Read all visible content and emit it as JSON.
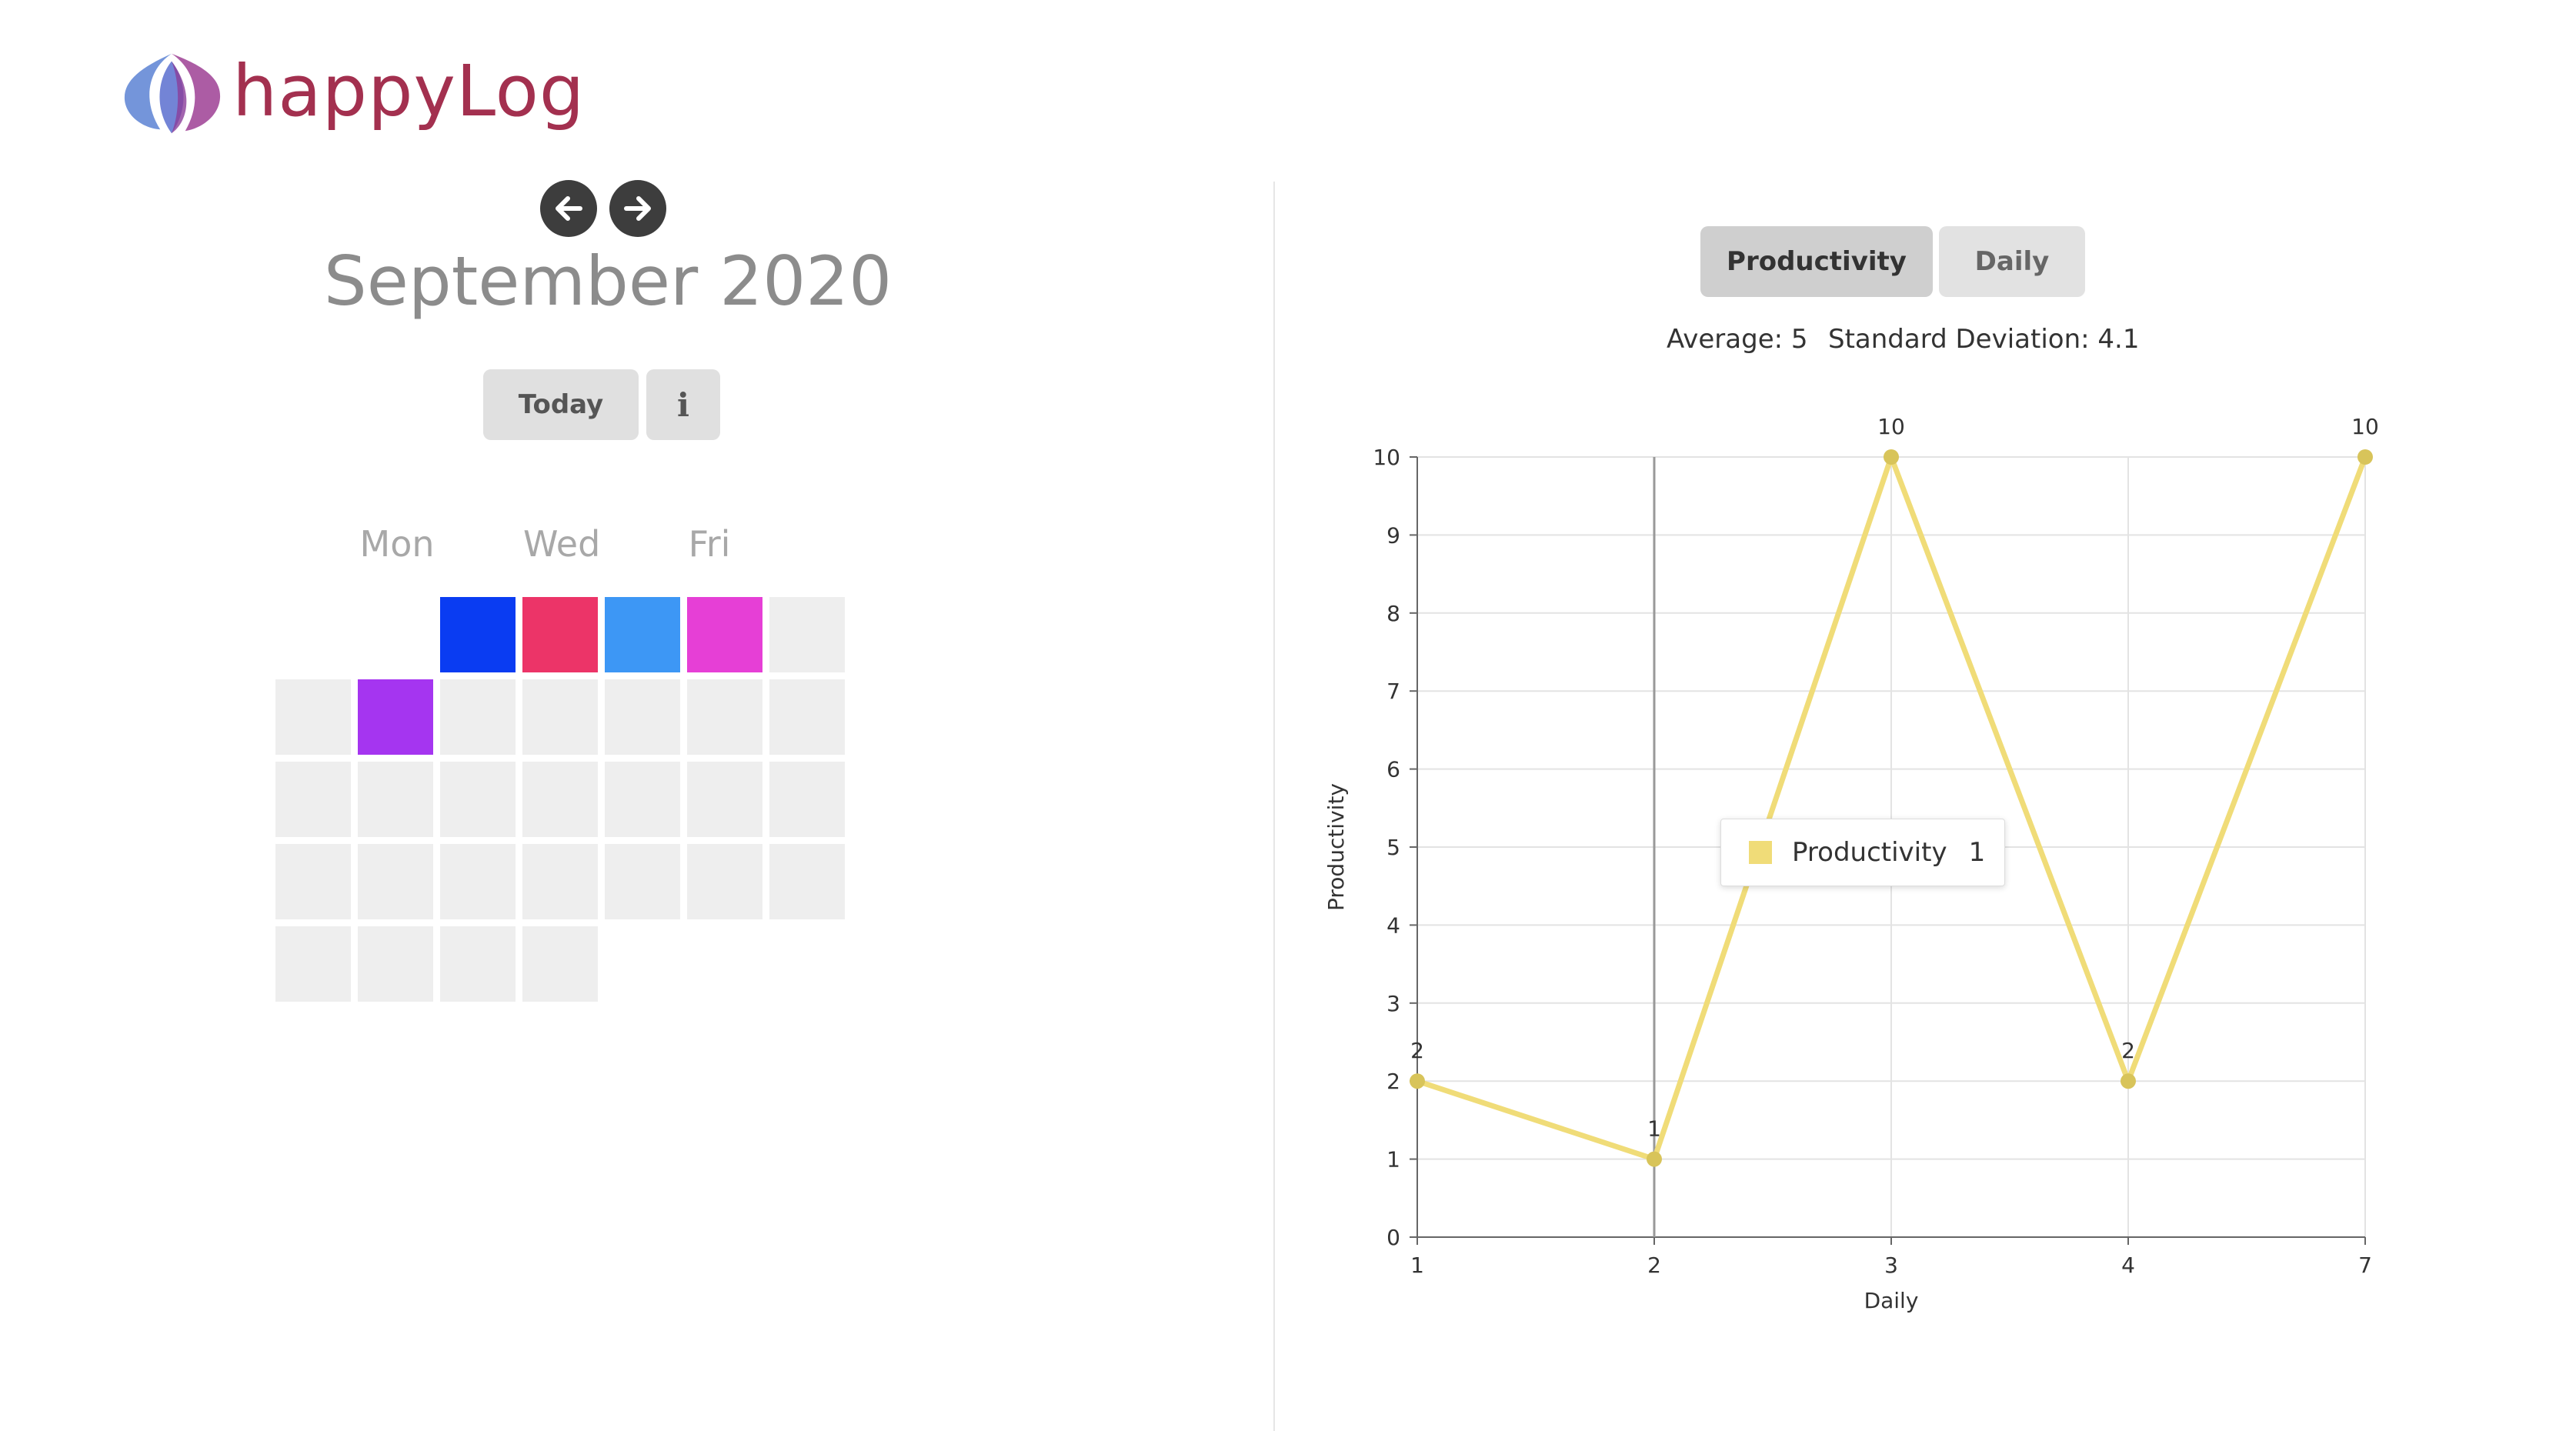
{
  "app": {
    "name": "happyLog"
  },
  "calendar": {
    "month_title": "September 2020",
    "today_label": "Today",
    "info_icon": "info-icon",
    "prev_icon": "arrow-left-icon",
    "next_icon": "arrow-right-icon",
    "weekday_labels": [
      "Mon",
      "Wed",
      "Fri"
    ],
    "colored_days": [
      {
        "day": 1,
        "color": "#0a3cf2"
      },
      {
        "day": 2,
        "color": "#ec3468"
      },
      {
        "day": 3,
        "color": "#3d97f5"
      },
      {
        "day": 4,
        "color": "#e63fd6"
      },
      {
        "day": 7,
        "color": "#a535f0"
      }
    ],
    "empty_cell_color": "#eeeeee"
  },
  "tabs": [
    {
      "label": "Productivity",
      "active": true
    },
    {
      "label": "Daily",
      "active": false
    }
  ],
  "stats": {
    "average": "Average: 5",
    "std_dev": "Standard Deviation: 4.1"
  },
  "tooltip": {
    "series": "Productivity",
    "value": "1"
  },
  "chart_data": {
    "type": "line",
    "x": [
      "1",
      "2",
      "3",
      "4",
      "7"
    ],
    "series": [
      {
        "name": "Productivity",
        "values": [
          2,
          1,
          10,
          2,
          10
        ],
        "color": "#f0dc78",
        "point_color": "#d8c45a"
      }
    ],
    "data_labels": [
      "2",
      "1",
      "10",
      "2",
      "10"
    ],
    "xlabel": "Daily",
    "ylabel": "Productivity",
    "ylim": [
      0,
      10
    ],
    "yticks": [
      "0",
      "1",
      "2",
      "3",
      "4",
      "5",
      "6",
      "7",
      "8",
      "9",
      "10"
    ],
    "grid": true,
    "highlighted_x": "2"
  }
}
